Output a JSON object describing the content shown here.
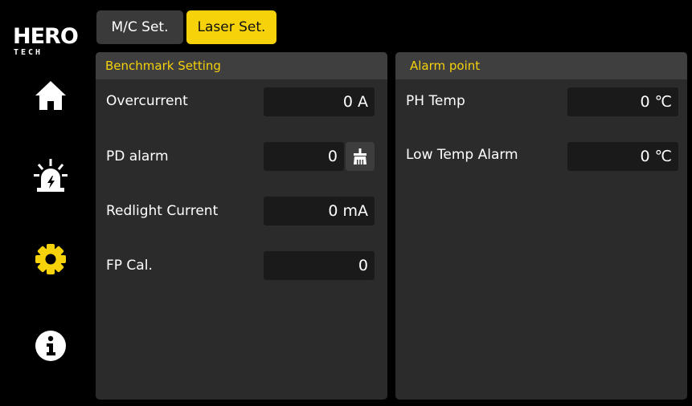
{
  "logo": {
    "main": "HERO",
    "sub": "TECH"
  },
  "nav": [
    {
      "icon": "home-icon"
    },
    {
      "icon": "alarm-light-icon"
    },
    {
      "icon": "gear-icon",
      "active": true
    },
    {
      "icon": "info-icon"
    }
  ],
  "tabs": [
    {
      "label": "M/C Set.",
      "active": false
    },
    {
      "label": "Laser Set.",
      "active": true
    }
  ],
  "benchmark": {
    "title": "Benchmark Setting",
    "rows": [
      {
        "label": "Overcurrent",
        "value": "0 A"
      },
      {
        "label": "PD alarm",
        "value": "0"
      },
      {
        "label": "Redlight Current",
        "value": "0 mA"
      },
      {
        "label": "FP Cal.",
        "value": "0"
      }
    ]
  },
  "alarm": {
    "title": "Alarm point",
    "rows": [
      {
        "label": "PH Temp",
        "value": "0 ℃"
      },
      {
        "label": "Low Temp Alarm",
        "value": "0 ℃"
      }
    ]
  },
  "colors": {
    "accent": "#f5d20a",
    "panel": "#2b2b2b",
    "panel_header": "#3f3f3f",
    "field": "#1a1a1a"
  }
}
